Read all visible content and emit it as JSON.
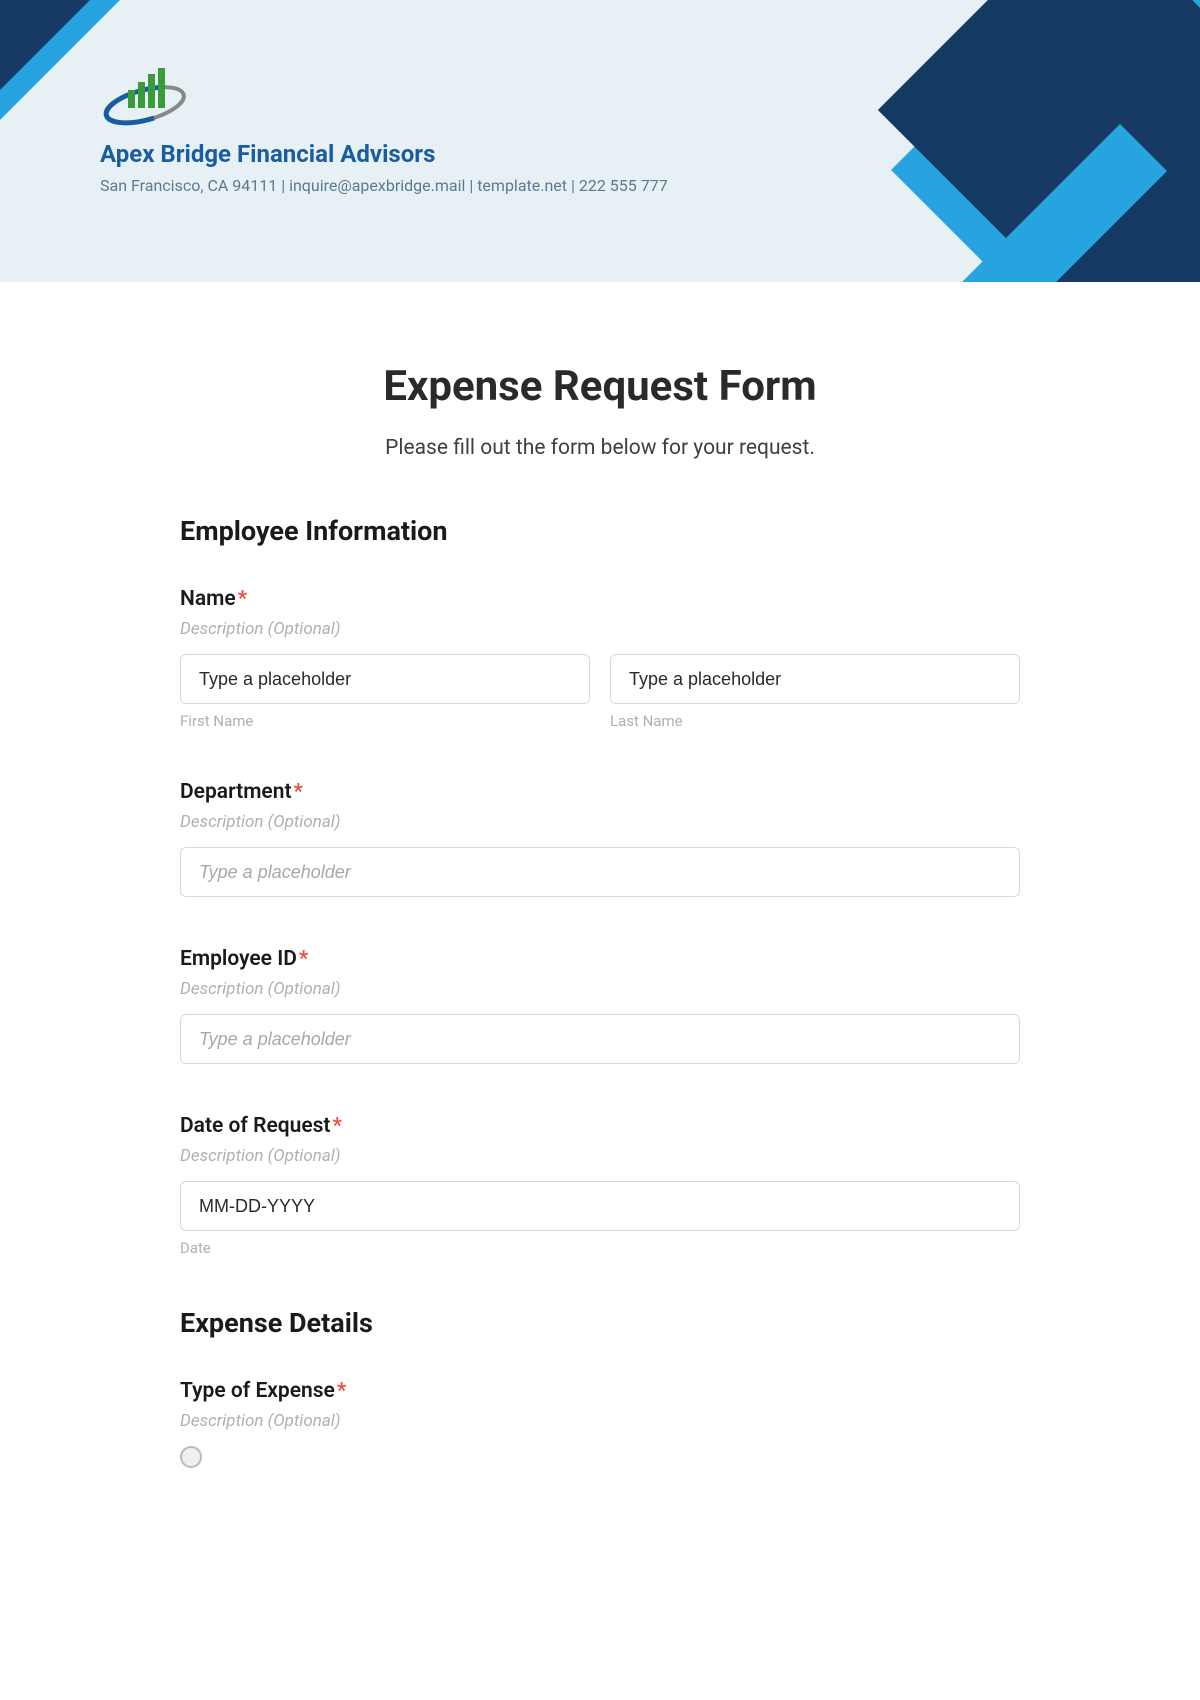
{
  "header": {
    "companyName": "Apex Bridge Financial Advisors",
    "companyInfo": "San Francisco, CA 94111 | inquire@apexbridge.mail | template.net | 222 555 777"
  },
  "form": {
    "title": "Expense Request Form",
    "subtitle": "Please fill out the form below for your request.",
    "sections": {
      "employeeInfo": {
        "title": "Employee Information",
        "fields": {
          "name": {
            "label": "Name",
            "desc": "Description (Optional)",
            "firstPlaceholder": "Type a placeholder",
            "firstSublabel": "First Name",
            "lastPlaceholder": "Type a placeholder",
            "lastSublabel": "Last Name"
          },
          "department": {
            "label": "Department",
            "desc": "Description (Optional)",
            "placeholder": "Type a placeholder"
          },
          "employeeId": {
            "label": "Employee ID",
            "desc": "Description (Optional)",
            "placeholder": "Type a placeholder"
          },
          "dateOfRequest": {
            "label": "Date of Request",
            "desc": "Description (Optional)",
            "placeholder": "MM-DD-YYYY",
            "sublabel": "Date"
          }
        }
      },
      "expenseDetails": {
        "title": "Expense Details",
        "fields": {
          "typeOfExpense": {
            "label": "Type of Expense",
            "desc": "Description (Optional)"
          }
        }
      }
    }
  }
}
